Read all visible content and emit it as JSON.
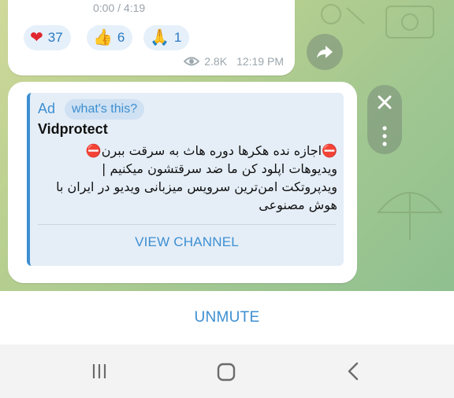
{
  "top_message": {
    "progress_text": "0:00 / 4:19",
    "reactions": [
      {
        "emoji": "❤",
        "count": "37"
      },
      {
        "emoji": "👍",
        "count": "6"
      },
      {
        "emoji": "🙏",
        "count": "1"
      }
    ],
    "views": "2.8K",
    "time": "12:19 PM"
  },
  "ad": {
    "tag": "Ad",
    "whats_this": "what's this?",
    "title": "Vidprotect",
    "body": "⛔اجازه نده هکرها دوره هاث به سرقت ببرن⛔\nویدیوهات اپلود کن ما ضد سرقتشون میکنیم |\nویدپروتکت امن‌ترین سرویس میزبانی ویدیو در ایران با\nهوش مصنوعی",
    "cta": "VIEW CHANNEL"
  },
  "bottom_bar": {
    "unmute_label": "UNMUTE"
  },
  "colors": {
    "accent": "#3d8fd2",
    "reaction_bg": "#e6f0fa",
    "ad_bg": "#e5eef7"
  },
  "icons": [
    "share-arrow-icon",
    "eye-icon",
    "close-icon",
    "more-vertical-icon",
    "recent-apps-icon",
    "home-icon",
    "back-icon"
  ]
}
